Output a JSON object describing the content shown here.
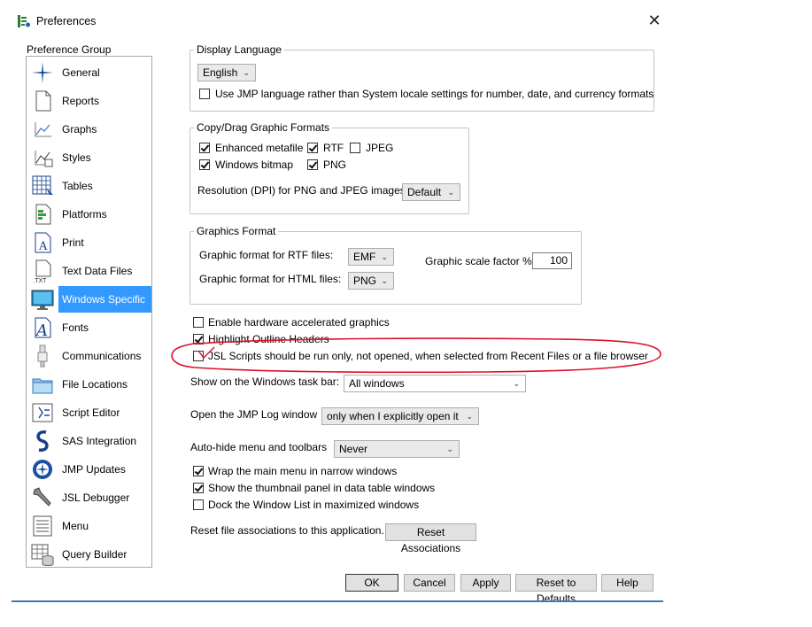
{
  "window": {
    "title": "Preferences",
    "close_label": "✕"
  },
  "sidebar": {
    "label": "Preference Group",
    "items": [
      {
        "label": "General",
        "icon": "general-icon"
      },
      {
        "label": "Reports",
        "icon": "reports-icon"
      },
      {
        "label": "Graphs",
        "icon": "graphs-icon"
      },
      {
        "label": "Styles",
        "icon": "styles-icon"
      },
      {
        "label": "Tables",
        "icon": "tables-icon"
      },
      {
        "label": "Platforms",
        "icon": "platforms-icon"
      },
      {
        "label": "Print",
        "icon": "print-icon"
      },
      {
        "label": "Text Data Files",
        "icon": "text-data-files-icon"
      },
      {
        "label": "Windows Specific",
        "icon": "windows-specific-icon",
        "selected": true
      },
      {
        "label": "Fonts",
        "icon": "fonts-icon"
      },
      {
        "label": "Communications",
        "icon": "communications-icon"
      },
      {
        "label": "File Locations",
        "icon": "file-locations-icon"
      },
      {
        "label": "Script Editor",
        "icon": "script-editor-icon"
      },
      {
        "label": "SAS Integration",
        "icon": "sas-integration-icon"
      },
      {
        "label": "JMP Updates",
        "icon": "jmp-updates-icon"
      },
      {
        "label": "JSL Debugger",
        "icon": "jsl-debugger-icon"
      },
      {
        "label": "Menu",
        "icon": "menu-icon"
      },
      {
        "label": "Query Builder",
        "icon": "query-builder-icon"
      }
    ]
  },
  "display_language": {
    "legend": "Display Language",
    "language": "English",
    "use_jmp_language_label": "Use JMP language rather than System locale settings for number, date, and currency formats",
    "use_jmp_language_checked": false
  },
  "copy_drag": {
    "legend": "Copy/Drag Graphic Formats",
    "enhanced_metafile": {
      "label": "Enhanced metafile",
      "checked": true
    },
    "rtf": {
      "label": "RTF",
      "checked": true
    },
    "jpeg": {
      "label": "JPEG",
      "checked": false
    },
    "windows_bitmap": {
      "label": "Windows bitmap",
      "checked": true
    },
    "png": {
      "label": "PNG",
      "checked": true
    },
    "resolution_label": "Resolution (DPI) for PNG and JPEG images:",
    "resolution_value": "Default"
  },
  "graphics_format": {
    "legend": "Graphics Format",
    "rtf_label": "Graphic format for RTF files:",
    "rtf_value": "EMF",
    "html_label": "Graphic format for HTML files:",
    "html_value": "PNG",
    "scale_label": "Graphic scale factor %",
    "scale_value": "100"
  },
  "options": {
    "hw_accel": {
      "label": "Enable hardware accelerated graphics",
      "checked": false
    },
    "highlight_outline": {
      "label": "Highlight Outline Headers",
      "checked": true
    },
    "jsl_run_only": {
      "label": "JSL Scripts should be run only, not opened, when selected from Recent Files or a file browser",
      "checked": false
    },
    "taskbar_label": "Show on the Windows task bar:",
    "taskbar_value": "All windows",
    "log_label": "Open the JMP Log window",
    "log_value": "only when I explicitly open it",
    "autohide_label": "Auto-hide menu and toolbars",
    "autohide_value": "Never",
    "wrap_menu": {
      "label": "Wrap the main menu in narrow windows",
      "checked": true
    },
    "thumbnail_panel": {
      "label": "Show the thumbnail panel in data table windows",
      "checked": true
    },
    "dock_window_list": {
      "label": "Dock the Window List in maximized windows",
      "checked": false
    },
    "reset_assoc_label": "Reset file associations to this application.",
    "reset_assoc_button": "Reset Associations"
  },
  "buttons": {
    "ok": "OK",
    "cancel": "Cancel",
    "apply": "Apply",
    "reset_defaults": "Reset to Defaults",
    "help": "Help"
  },
  "annotation": {
    "color": "#e0102a",
    "shape": "hand-drawn ellipse around JSL Scripts option"
  }
}
